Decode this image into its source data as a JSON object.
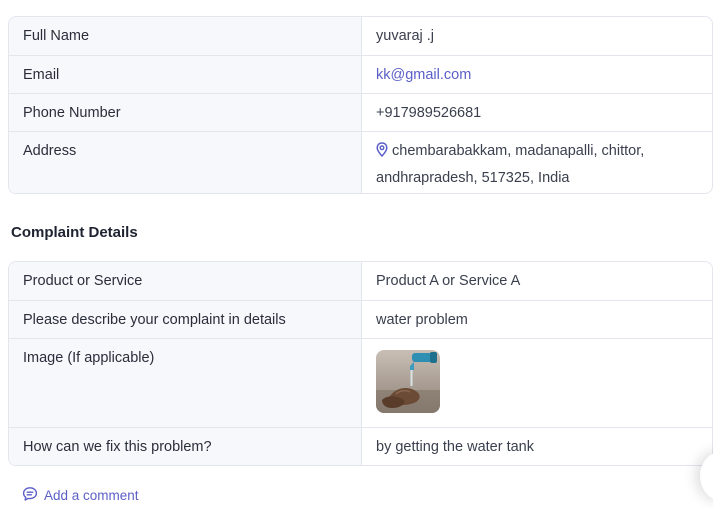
{
  "personal_info": {
    "rows": [
      {
        "label": "Full Name",
        "value": "yuvaraj .j"
      },
      {
        "label": "Email",
        "value": "kk@gmail.com"
      },
      {
        "label": "Phone Number",
        "value": "+917989526681"
      },
      {
        "label": "Address",
        "value_line1": "chembarabakkam, madanapalli, chittor,",
        "value_line2": "andhrapradesh, 517325, India"
      }
    ]
  },
  "complaint": {
    "title": "Complaint Details",
    "rows": [
      {
        "label": "Product or Service",
        "value": "Product A or Service A"
      },
      {
        "label": "Please describe your complaint in details",
        "value": "water problem"
      },
      {
        "label": "Image (If applicable)",
        "value_icon": "water-tap-photo"
      },
      {
        "label": "How can we fix this problem?",
        "value": "by getting the water tank"
      }
    ]
  },
  "actions": {
    "add_comment": "Add a comment"
  },
  "colors": {
    "accent": "#5b5fc7",
    "label_bg": "#f7f8fc",
    "border": "#e4e6ee"
  }
}
